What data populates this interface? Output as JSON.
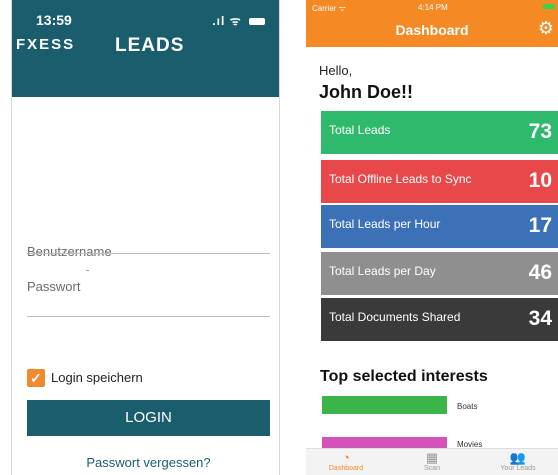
{
  "login": {
    "status_time": "13:59",
    "logo": "FXESS",
    "title": "LEADS",
    "username_label": "Benutzername",
    "password_label": "Passwort",
    "remember_label": "Login speichern",
    "remember_checked": true,
    "login_button": "LOGIN",
    "forgot_link": "Passwort vergessen?",
    "colors": {
      "header": "#1a5e6e",
      "accent": "#f08a2c"
    }
  },
  "dashboard": {
    "status": {
      "carrier": "Carrier ᯤ",
      "time": "4:14 PM"
    },
    "title": "Dashboard",
    "greeting": "Hello,",
    "user_name": "John Doe!!",
    "cards": [
      {
        "label": "Total Leads",
        "value": "73",
        "color": "#2fb96c"
      },
      {
        "label": "Total Offline Leads to Sync",
        "value": "10",
        "color": "#e8484a"
      },
      {
        "label": "Total Leads per Hour",
        "value": "17",
        "color": "#3c71b8"
      },
      {
        "label": "Total Leads per Day",
        "value": "46",
        "color": "#8f8f8f"
      },
      {
        "label": "Total Documents Shared",
        "value": "34",
        "color": "#3a3a3a"
      }
    ],
    "interests_title": "Top selected interests",
    "interests": [
      {
        "label": "Boats",
        "color": "#3bb54a"
      },
      {
        "label": "Movies",
        "color": "#d552b8"
      }
    ],
    "tabs": [
      {
        "label": "Dashboard",
        "icon": "dashboard-icon",
        "active": true
      },
      {
        "label": "Scan",
        "icon": "qr-scan-icon",
        "active": false
      },
      {
        "label": "Your Leads",
        "icon": "users-icon",
        "active": false
      }
    ]
  }
}
